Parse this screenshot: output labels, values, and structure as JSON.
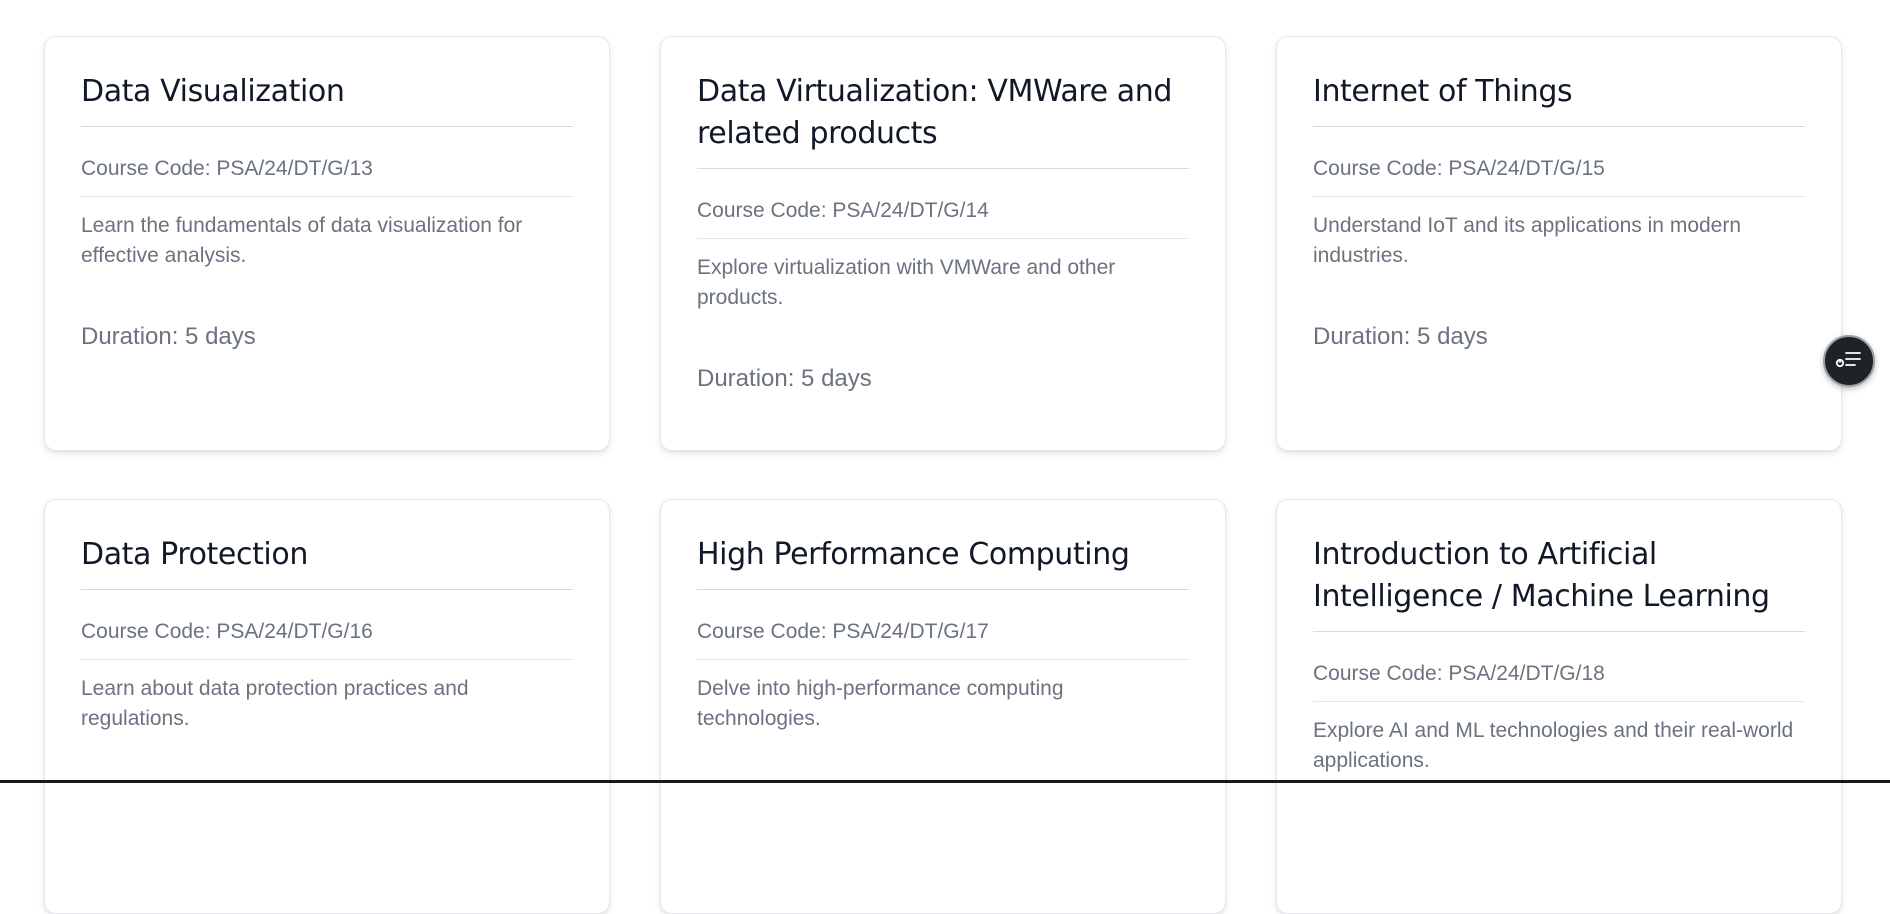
{
  "courses": [
    {
      "title": "Data Visualization",
      "code": "Course Code: PSA/24/DT/G/13",
      "description": "Learn the fundamentals of data visualization for effective analysis.",
      "duration": "Duration: 5 days"
    },
    {
      "title": "Data Virtualization: VMWare and related products",
      "code": "Course Code: PSA/24/DT/G/14",
      "description": "Explore virtualization with VMWare and other products.",
      "duration": "Duration: 5 days"
    },
    {
      "title": "Internet of Things",
      "code": "Course Code: PSA/24/DT/G/15",
      "description": "Understand IoT and its applications in modern industries.",
      "duration": "Duration: 5 days"
    },
    {
      "title": "Data Protection",
      "code": "Course Code: PSA/24/DT/G/16",
      "description": "Learn about data protection practices and regulations.",
      "duration": ""
    },
    {
      "title": "High Performance Computing",
      "code": "Course Code: PSA/24/DT/G/17",
      "description": "Delve into high-performance computing technologies.",
      "duration": ""
    },
    {
      "title": "Introduction to Artificial Intelligence / Machine Learning",
      "code": "Course Code: PSA/24/DT/G/18",
      "description": "Explore AI and ML technologies and their real-world applications.",
      "duration": ""
    }
  ],
  "floating_button": {
    "icon": "reader-menu-icon"
  },
  "colors": {
    "title": "#111827",
    "muted_text": "#6b7280",
    "card_border": "#e5e7eb",
    "fab_background": "#1f2328"
  }
}
